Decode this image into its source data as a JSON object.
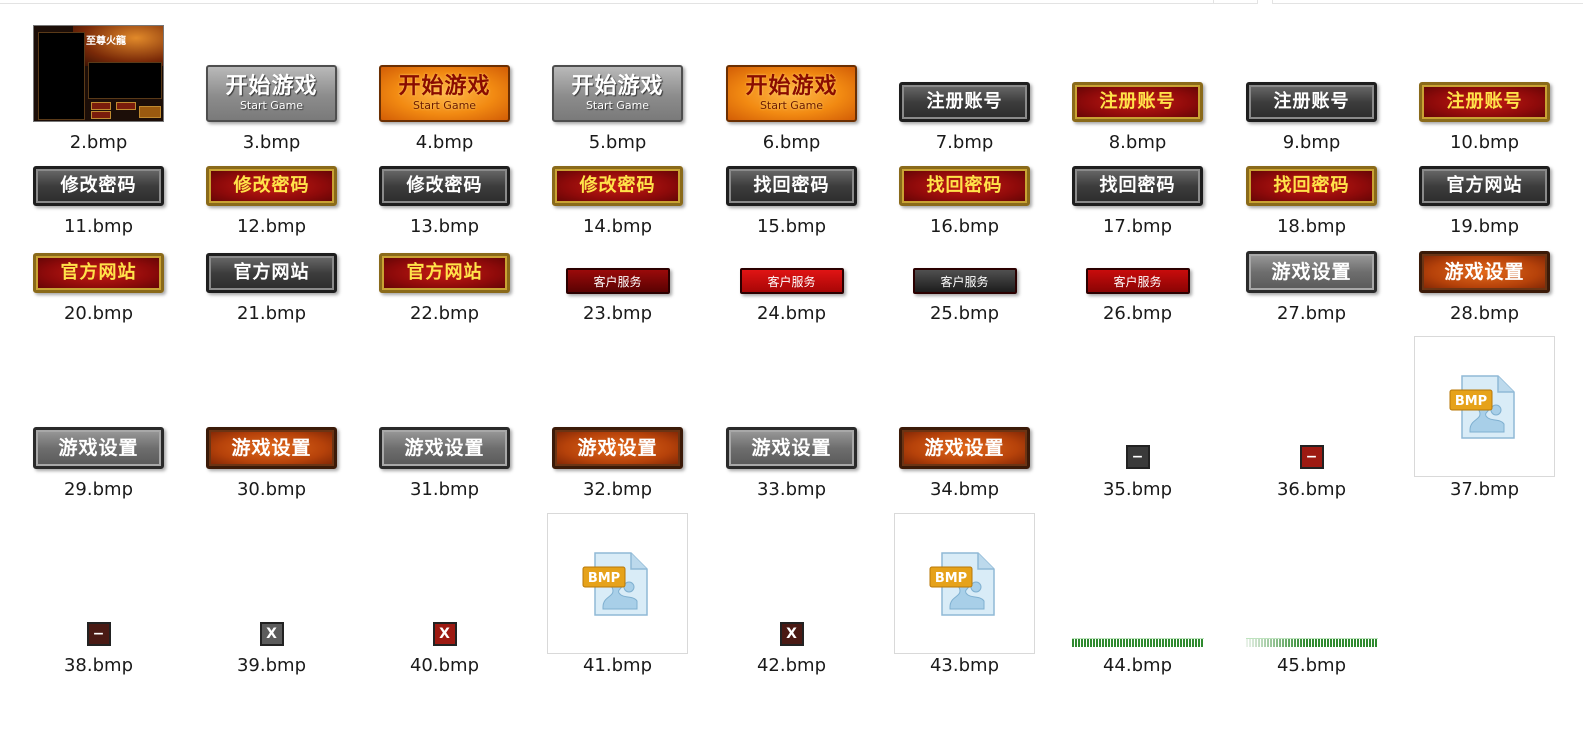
{
  "files": [
    {
      "name": "2.bmp",
      "kind": "screen",
      "text": "至尊火龍"
    },
    {
      "name": "3.bmp",
      "kind": "big-gray",
      "text": "开始游戏",
      "sub": "Start Game"
    },
    {
      "name": "4.bmp",
      "kind": "big-orange",
      "text": "开始游戏",
      "sub": "Start Game"
    },
    {
      "name": "5.bmp",
      "kind": "big-gray",
      "text": "开始游戏",
      "sub": "Start Game"
    },
    {
      "name": "6.bmp",
      "kind": "big-orange",
      "text": "开始游戏",
      "sub": "Start Game"
    },
    {
      "name": "7.bmp",
      "kind": "m-gray",
      "text": "注册账号"
    },
    {
      "name": "8.bmp",
      "kind": "m-red",
      "text": "注册账号"
    },
    {
      "name": "9.bmp",
      "kind": "m-gray",
      "text": "注册账号"
    },
    {
      "name": "10.bmp",
      "kind": "m-red",
      "text": "注册账号"
    },
    {
      "name": "11.bmp",
      "kind": "m-gray",
      "text": "修改密码"
    },
    {
      "name": "12.bmp",
      "kind": "m-red",
      "text": "修改密码"
    },
    {
      "name": "13.bmp",
      "kind": "m-gray",
      "text": "修改密码"
    },
    {
      "name": "14.bmp",
      "kind": "m-red",
      "text": "修改密码"
    },
    {
      "name": "15.bmp",
      "kind": "m-gray",
      "text": "找回密码"
    },
    {
      "name": "16.bmp",
      "kind": "m-red",
      "text": "找回密码"
    },
    {
      "name": "17.bmp",
      "kind": "m-gray",
      "text": "找回密码"
    },
    {
      "name": "18.bmp",
      "kind": "m-red",
      "text": "找回密码"
    },
    {
      "name": "19.bmp",
      "kind": "m-gray",
      "text": "官方网站"
    },
    {
      "name": "20.bmp",
      "kind": "m-red",
      "text": "官方网站"
    },
    {
      "name": "21.bmp",
      "kind": "m-gray",
      "text": "官方网站"
    },
    {
      "name": "22.bmp",
      "kind": "m-red",
      "text": "官方网站"
    },
    {
      "name": "23.bmp",
      "kind": "s-dark",
      "text": "客户服务"
    },
    {
      "name": "24.bmp",
      "kind": "s-red",
      "text": "客户服务"
    },
    {
      "name": "25.bmp",
      "kind": "s-black",
      "text": "客户服务"
    },
    {
      "name": "26.bmp",
      "kind": "s-red2",
      "text": "客户服务"
    },
    {
      "name": "27.bmp",
      "kind": "set-gray",
      "text": "游戏设置"
    },
    {
      "name": "28.bmp",
      "kind": "set-orange",
      "text": "游戏设置"
    },
    {
      "name": "29.bmp",
      "kind": "set-gray",
      "text": "游戏设置"
    },
    {
      "name": "30.bmp",
      "kind": "set-orange",
      "text": "游戏设置"
    },
    {
      "name": "31.bmp",
      "kind": "set-gray",
      "text": "游戏设置"
    },
    {
      "name": "32.bmp",
      "kind": "set-orange",
      "text": "游戏设置"
    },
    {
      "name": "33.bmp",
      "kind": "set-gray",
      "text": "游戏设置"
    },
    {
      "name": "34.bmp",
      "kind": "set-orange",
      "text": "游戏设置"
    },
    {
      "name": "35.bmp",
      "kind": "sq-dgray",
      "text": "−"
    },
    {
      "name": "36.bmp",
      "kind": "sq-red",
      "text": "−"
    },
    {
      "name": "37.bmp",
      "kind": "file-icon",
      "text": "BMP"
    },
    {
      "name": "38.bmp",
      "kind": "sq-dred",
      "text": "−"
    },
    {
      "name": "39.bmp",
      "kind": "sq-gray",
      "text": "X"
    },
    {
      "name": "40.bmp",
      "kind": "sq-red",
      "text": "X"
    },
    {
      "name": "41.bmp",
      "kind": "file-icon",
      "text": "BMP"
    },
    {
      "name": "42.bmp",
      "kind": "sq-dred",
      "text": "X"
    },
    {
      "name": "43.bmp",
      "kind": "file-icon",
      "text": "BMP"
    },
    {
      "name": "44.bmp",
      "kind": "bar",
      "text": ""
    },
    {
      "name": "45.bmp",
      "kind": "bar-fade",
      "text": ""
    }
  ]
}
